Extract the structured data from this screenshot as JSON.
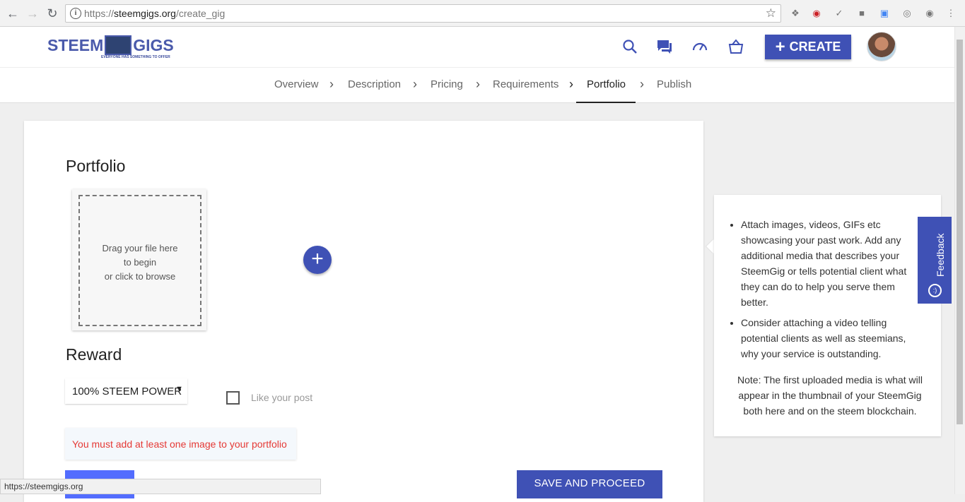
{
  "browser": {
    "url_scheme": "https://",
    "url_host": "steemgigs.org",
    "url_path": "/create_gig",
    "status_url": "https://steemgigs.org"
  },
  "header": {
    "logo_left": "STEEM",
    "logo_right": "GIGS",
    "logo_tagline": "EVERYONE HAS SOMETHING TO OFFER",
    "create_label": "CREATE"
  },
  "steps": [
    {
      "label": "Overview"
    },
    {
      "label": "Description"
    },
    {
      "label": "Pricing"
    },
    {
      "label": "Requirements"
    },
    {
      "label": "Portfolio"
    },
    {
      "label": "Publish"
    }
  ],
  "active_step": "Portfolio",
  "portfolio": {
    "heading": "Portfolio",
    "dropzone_line1": "Drag your file here",
    "dropzone_line2": "to begin",
    "dropzone_line3": "or click to browse"
  },
  "reward": {
    "heading": "Reward",
    "selected": "100% STEEM POWER",
    "like_label": "Like your post"
  },
  "error_message": "You must add at least one image to your portfolio",
  "save_label": "SAVE AND PROCEED",
  "info": {
    "bullets": [
      "Attach images, videos, GIFs etc showcasing your past work. Add any additional media that describes your SteemGig or tells potential client what they can do to help you serve them better.",
      "Consider attaching a video telling potential clients as well as steemians, why your service is outstanding."
    ],
    "note": "Note: The first uploaded media is what will appear in the thumbnail of your SteemGig both here and on the steem blockchain."
  },
  "feedback_label": "Feedback",
  "colors": {
    "brand": "#3f51b5",
    "error": "#e53935"
  }
}
